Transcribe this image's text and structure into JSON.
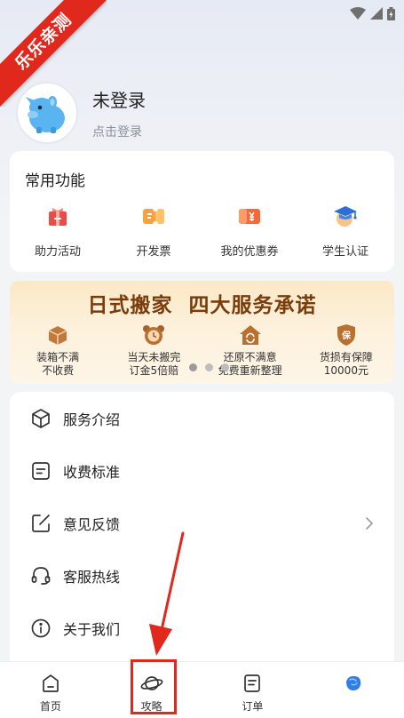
{
  "watermark": "乐乐亲测",
  "profile": {
    "name": "未登录",
    "subtitle": "点击登录"
  },
  "functions": {
    "title": "常用功能",
    "items": [
      {
        "label": "助力活动",
        "icon": "gift-bag-icon"
      },
      {
        "label": "开发票",
        "icon": "invoice-ticket-icon"
      },
      {
        "label": "我的优惠券",
        "icon": "coupon-icon"
      },
      {
        "label": "学生认证",
        "icon": "graduation-cap-icon"
      }
    ]
  },
  "banner": {
    "title": "日式搬家  四大服务承诺",
    "items": [
      {
        "line1": "装箱不满",
        "line2": "不收费",
        "icon": "box-icon"
      },
      {
        "line1": "当天未搬完",
        "line2": "订金5倍赔",
        "icon": "clock-bear-icon"
      },
      {
        "line1": "还原不满意",
        "line2": "免费重新整理",
        "icon": "house-refresh-icon"
      },
      {
        "line1": "货损有保障",
        "line2": "10000元",
        "icon": "shield-guarantee-icon"
      }
    ],
    "guarantee_badge": "保",
    "carousel_active_index": 0
  },
  "menu": [
    {
      "label": "服务介绍",
      "icon": "cube-icon"
    },
    {
      "label": "收费标准",
      "icon": "price-list-icon"
    },
    {
      "label": "意见反馈",
      "icon": "edit-feedback-icon"
    },
    {
      "label": "客服热线",
      "icon": "headset-icon"
    },
    {
      "label": "关于我们",
      "icon": "info-icon"
    }
  ],
  "tabs": [
    {
      "label": "首页",
      "icon": "home-icon"
    },
    {
      "label": "攻略",
      "icon": "planet-icon"
    },
    {
      "label": "订单",
      "icon": "order-icon"
    },
    {
      "label": "",
      "icon": "profile-blob-icon"
    }
  ],
  "colors": {
    "accent_red": "#e0281d",
    "banner_brown": "#7b3c0b",
    "icon_orange": "#f08a2a"
  }
}
